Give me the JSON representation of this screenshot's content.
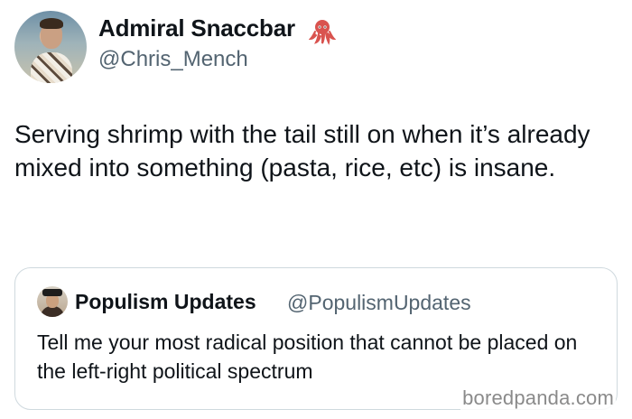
{
  "tweet": {
    "author": {
      "display_name": "Admiral Snaccbar",
      "handle": "@Chris_Mench",
      "badge_icon": "octopus-icon",
      "badge_color": "#d9534f"
    },
    "text": "Serving shrimp with the tail still on when it’s already mixed into something (pasta, rice, etc) is insane."
  },
  "quoted_tweet": {
    "author": {
      "display_name": "Populism Updates",
      "handle": "@PopulismUpdates"
    },
    "text": "Tell me your most radical position that cannot be placed on the left-right political spectrum"
  },
  "watermark": {
    "text": "boredpanda.com"
  },
  "colors": {
    "text_primary": "#0f1419",
    "text_secondary": "#536471",
    "card_border": "#cfd9de"
  }
}
